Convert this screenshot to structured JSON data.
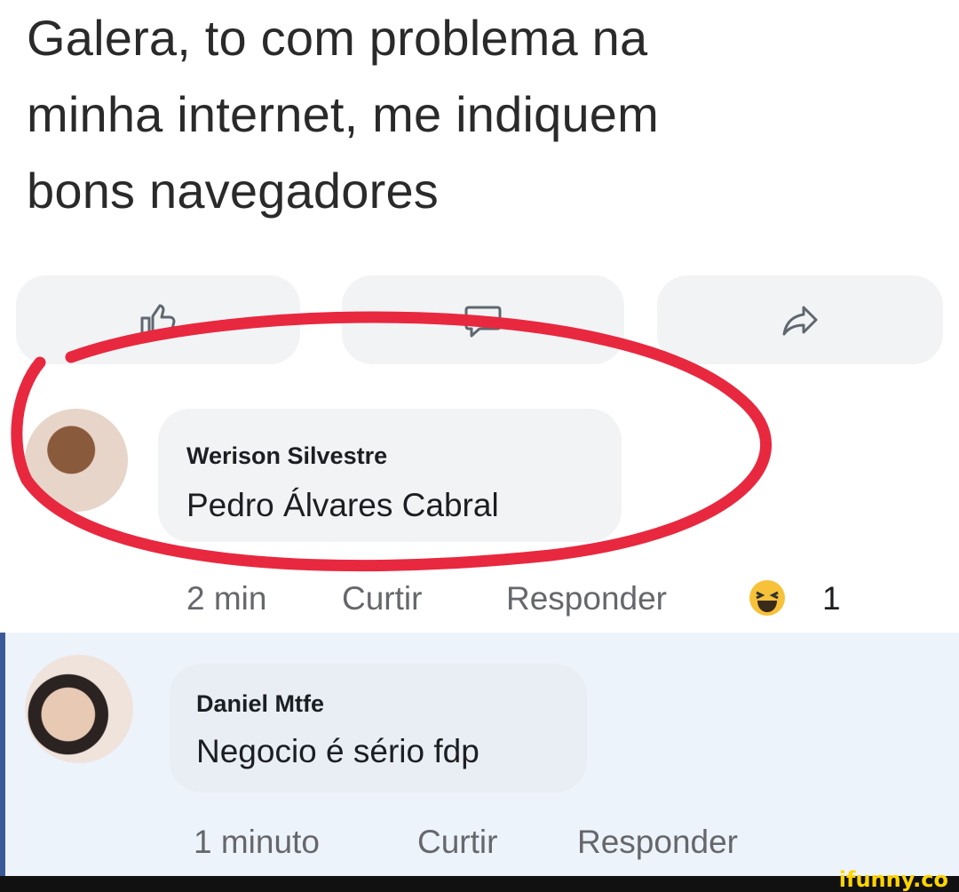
{
  "post": {
    "text_line1": "Galera, to com problema na",
    "text_line2": "minha internet, me indiquem",
    "text_line3": "bons navegadores"
  },
  "actions": {
    "like_icon": "thumbs-up-icon",
    "comment_icon": "comment-icon",
    "share_icon": "share-icon"
  },
  "comments": [
    {
      "author": "Werison Silvestre",
      "text": "Pedro Álvares Cabral",
      "time": "2 min",
      "like_label": "Curtir",
      "reply_label": "Responder",
      "reaction_icon": "haha-emoji-icon",
      "reaction_count": "1"
    },
    {
      "author": "Daniel Mtfe",
      "text": "Negocio é sério fdp",
      "time": "1 minuto",
      "like_label": "Curtir",
      "reply_label": "Responder"
    }
  ],
  "watermark": "ifunny.co",
  "colors": {
    "circle": "#e8283f",
    "reply_bg": "#edf3fb",
    "bubble": "#f2f3f5"
  }
}
